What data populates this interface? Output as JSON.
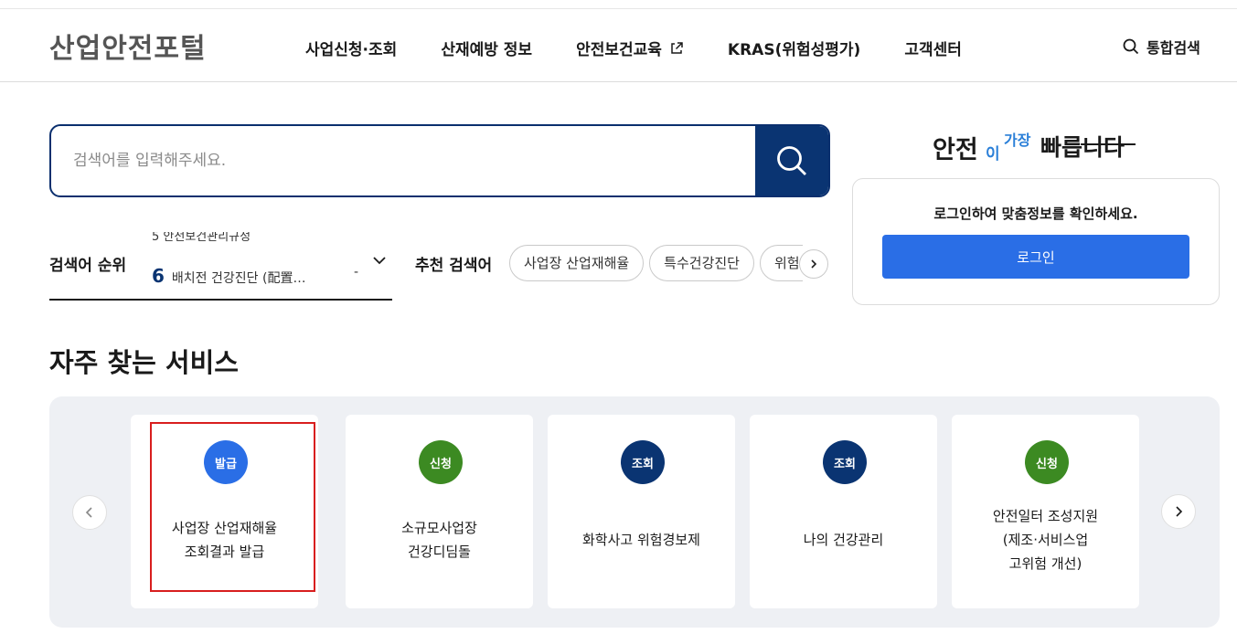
{
  "header": {
    "logo": "산업안전포털",
    "nav": [
      {
        "label": "사업신청·조회"
      },
      {
        "label": "산재예방 정보"
      },
      {
        "label": "안전보건교육"
      },
      {
        "label": "KRAS(위험성평가)"
      },
      {
        "label": "고객센터"
      }
    ],
    "search_label": "통합검색"
  },
  "search": {
    "placeholder": "검색어를 입력해주세요."
  },
  "ranking": {
    "label": "검색어 순위",
    "prev_item": "5  안전보건관리규정",
    "current_num": "6",
    "current_text": "배치전 건강진단 (配置…",
    "current_change": "-"
  },
  "recommended": {
    "label": "추천 검색어",
    "chips": [
      "사업장 산업재해율",
      "특수건강진단",
      "위험성평가"
    ]
  },
  "slogan": {
    "part1": "안전",
    "part2": "이",
    "part3": "가장",
    "part4": "빠릅니다"
  },
  "login": {
    "message": "로그인하여 맞춤정보를 확인하세요.",
    "button": "로그인"
  },
  "services": {
    "title": "자주 찾는 서비스",
    "cards": [
      {
        "badge": "발급",
        "badge_color": "#2a6ee6",
        "title": "사업장 산업재해율\n조회결과 발급"
      },
      {
        "badge": "신청",
        "badge_color": "#3c8a22",
        "title": "소규모사업장\n건강디딤돌"
      },
      {
        "badge": "조회",
        "badge_color": "#0a3472",
        "title": "화학사고 위험경보제"
      },
      {
        "badge": "조회",
        "badge_color": "#0a3472",
        "title": "나의 건강관리"
      },
      {
        "badge": "신청",
        "badge_color": "#3c8a22",
        "title": "안전일터 조성지원\n(제조·서비스업\n고위험 개선)"
      }
    ]
  }
}
